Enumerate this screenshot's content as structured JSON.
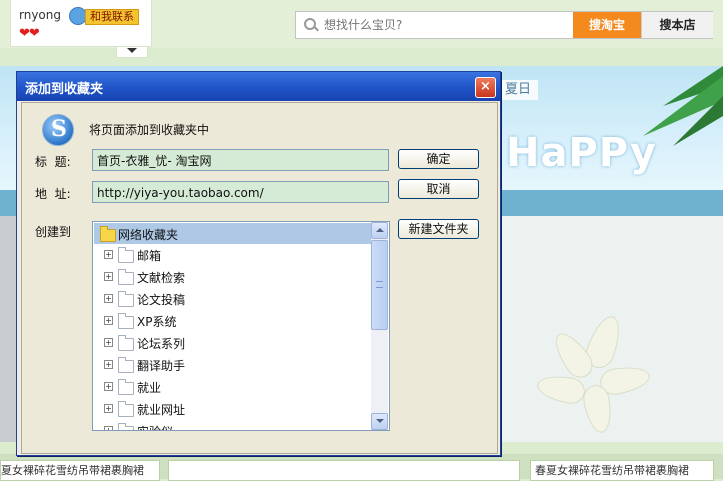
{
  "shop": {
    "seller_name": "rnyong",
    "contact_label": "和我联系",
    "hearts": "❤❤"
  },
  "search": {
    "placeholder": "想找什么宝贝?",
    "btn_taobao": "搜淘宝",
    "btn_shop": "搜本店"
  },
  "banner": {
    "summer_text": "夏日",
    "happy_text": "HaPPy"
  },
  "bottom_cards": [
    "夏女裸碎花雪纺吊带裙裹胸裙",
    "春夏女裸碎花雪纺吊带裙裹胸裙"
  ],
  "dialog": {
    "title": "添加到收藏夹",
    "close_glyph": "×",
    "info_text": "将页面添加到收藏夹中",
    "title_label": "标  题:",
    "title_value": "首页-衣雅_忧- 淘宝网",
    "address_label": "地  址:",
    "address_value": "http://yiya-you.taobao.com/",
    "create_in_label": "创建到",
    "ok_button": "确定",
    "cancel_button": "取消",
    "new_folder_button": "新建文件夹",
    "tree": {
      "root": "网络收藏夹",
      "folders": [
        "邮箱",
        "文献检索",
        "论文投稿",
        "XP系统",
        "论坛系列",
        "翻译助手",
        "就业",
        "就业网址",
        "实验仪"
      ]
    }
  }
}
